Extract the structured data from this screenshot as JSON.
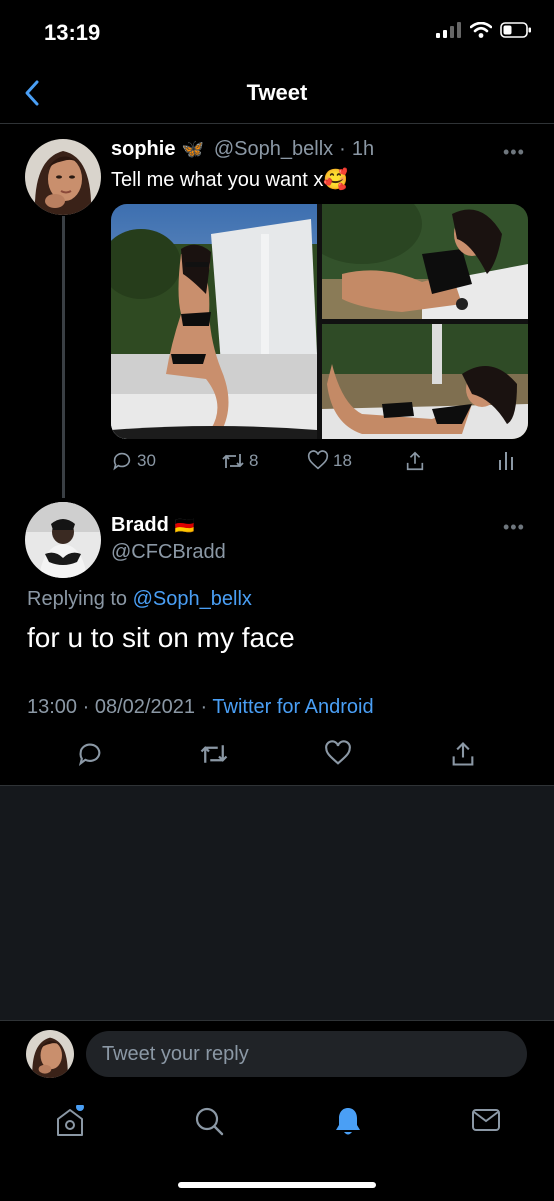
{
  "status_bar": {
    "time": "13:19"
  },
  "nav": {
    "title": "Tweet"
  },
  "original_tweet": {
    "display_name": "sophie",
    "name_emoji": "🦋",
    "handle": "@Soph_bellx",
    "separator": "·",
    "age": "1h",
    "text": "Tell me what you want x",
    "text_emoji": "🥰",
    "more": "•••",
    "stats": {
      "replies": "30",
      "retweets": "8",
      "likes": "18"
    }
  },
  "reply_tweet": {
    "display_name": "Bradd",
    "name_emoji": "🇩🇪",
    "handle": "@CFCBradd",
    "replying_prefix": "Replying to",
    "replying_handle": "@Soph_bellx",
    "text": "for u to sit on my face",
    "time": "13:00",
    "date": "08/02/2021",
    "dot": "·",
    "source": "Twitter for Android",
    "more": "•••"
  },
  "composer": {
    "placeholder": "Tweet your reply"
  },
  "colors": {
    "accent": "#4a9ff5",
    "muted": "#8b98a5",
    "background": "#000000"
  }
}
